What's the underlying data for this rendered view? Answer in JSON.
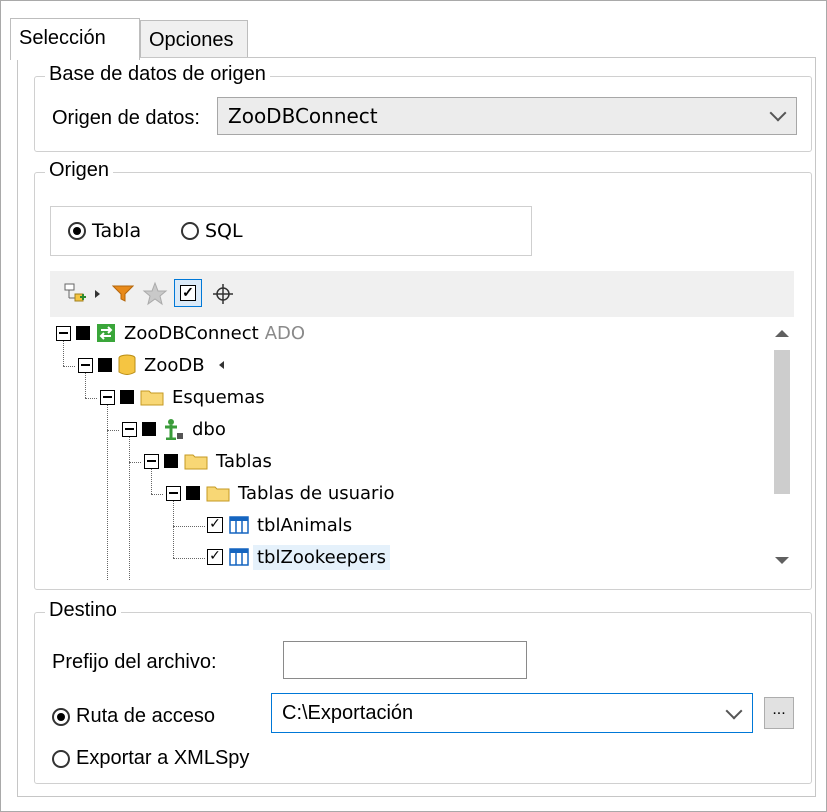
{
  "tabs": [
    {
      "label": "Selección",
      "active": true
    },
    {
      "label": "Opciones",
      "active": false
    }
  ],
  "source_db": {
    "legend": "Base de datos de origen",
    "label": "Origen de datos:",
    "value": "ZooDBConnect"
  },
  "origin": {
    "legend": "Origen",
    "radio_table": "Tabla",
    "radio_sql": "SQL",
    "selected": "Tabla",
    "toolbar_icons": [
      "add-object-icon",
      "expand-arrow-icon",
      "filter-icon",
      "favorites-star-icon",
      "checked-only-icon",
      "locate-icon"
    ],
    "tree": [
      {
        "label": "ZooDBConnect",
        "suffix": "ADO",
        "icon": "connection-icon"
      },
      {
        "label": "ZooDB",
        "icon": "database-icon"
      },
      {
        "label": "Esquemas",
        "icon": "folder-icon"
      },
      {
        "label": "dbo",
        "icon": "schema-icon"
      },
      {
        "label": "Tablas",
        "icon": "folder-icon"
      },
      {
        "label": "Tablas de usuario",
        "icon": "folder-icon"
      },
      {
        "label": "tblAnimals",
        "icon": "table-icon",
        "checked": true
      },
      {
        "label": "tblZookeepers",
        "icon": "table-icon",
        "checked": true,
        "selected": true
      }
    ]
  },
  "destination": {
    "legend": "Destino",
    "prefix_label": "Prefijo del archivo:",
    "prefix_value": "",
    "path_radio": "Ruta de acceso",
    "path_value": "C:\\Exportación",
    "browse_label": "...",
    "xmlspy_radio": "Exportar a XMLSpy",
    "selected": "Ruta de acceso"
  },
  "colors": {
    "accent": "#0078d7",
    "folder": "#f5c542",
    "table_icon": "#1565c0",
    "schema_icon": "#2e8b2e",
    "selection_bg": "#e5f1fb"
  }
}
